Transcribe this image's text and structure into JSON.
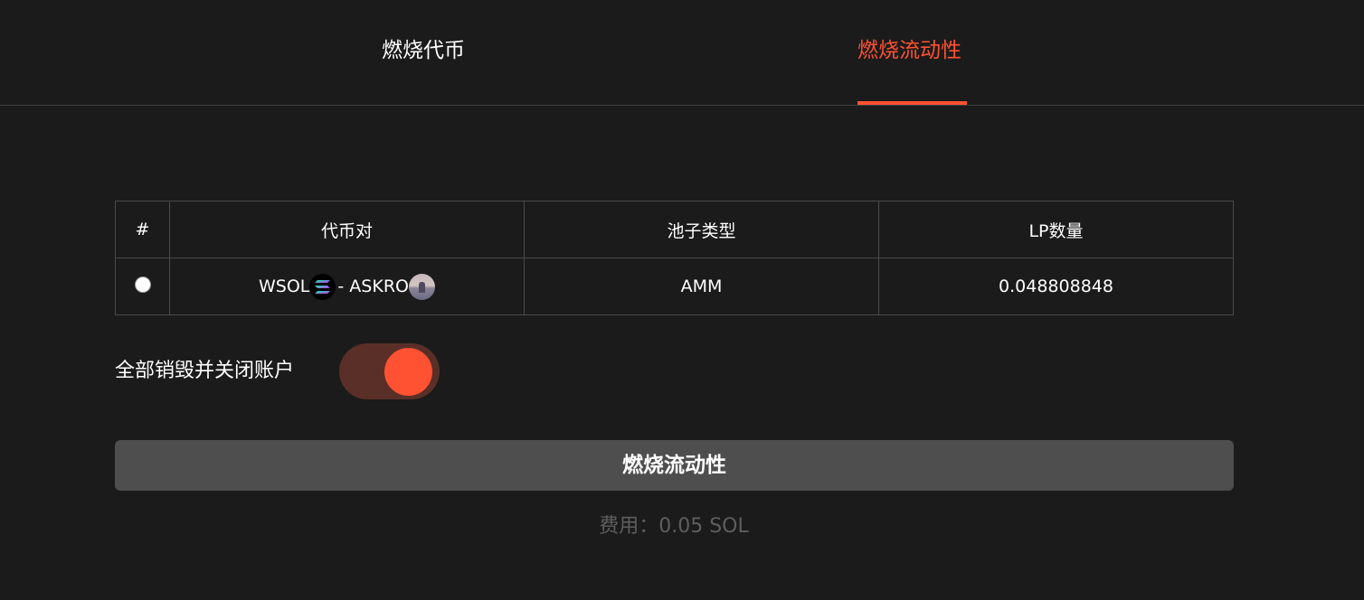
{
  "tabs": [
    {
      "label": "燃烧代币",
      "active": false
    },
    {
      "label": "燃烧流动性",
      "active": true
    }
  ],
  "colors": {
    "accent": "#ff5233",
    "background": "#1b1b1b",
    "button": "#4e4e4e",
    "toggle_track": "#5a2f27"
  },
  "table": {
    "headers": [
      "#",
      "代币对",
      "池子类型",
      "LP数量"
    ],
    "rows": [
      {
        "selected": false,
        "token_a": "WSOL",
        "token_a_icon": "solana-icon",
        "separator": "- ",
        "token_b": "ASKRO",
        "token_b_icon": "askro-token-icon",
        "pool_type": "AMM",
        "lp_amount": "0.048808848"
      }
    ]
  },
  "close_accounts": {
    "label": "全部销毁并关闭账户",
    "enabled": true
  },
  "burn_button_label": "燃烧流动性",
  "fee_text": "费用：0.05 SOL"
}
